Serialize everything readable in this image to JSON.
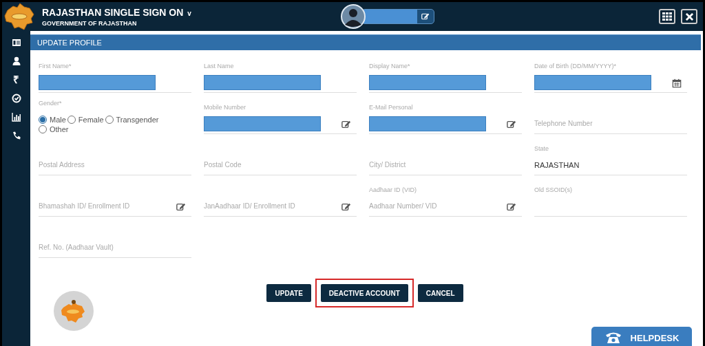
{
  "header": {
    "title": "RAJASTHAN SINGLE SIGN ON",
    "title_caret": "v",
    "subtitle": "GOVERNMENT OF RAJASTHAN",
    "user": {
      "name_redacted": true
    }
  },
  "sidebar": {
    "items": [
      {
        "kind": "id-card"
      },
      {
        "kind": "user"
      },
      {
        "kind": "glyph",
        "glyph": "₹"
      },
      {
        "kind": "check"
      },
      {
        "kind": "chart"
      },
      {
        "kind": "phone"
      }
    ]
  },
  "panel": {
    "title": "UPDATE PROFILE"
  },
  "form": {
    "rows": [
      [
        {
          "kind": "input",
          "label": "First Name*",
          "redacted": true
        },
        {
          "kind": "input",
          "label": "Last Name",
          "redacted": true
        },
        {
          "kind": "input",
          "label": "Display Name*",
          "redacted": true
        },
        {
          "kind": "date",
          "label": "Date of Birth (DD/MM/YYYY)*",
          "redacted": true
        }
      ],
      [
        {
          "kind": "radio",
          "label": "Gender*",
          "options": [
            {
              "label": "Male",
              "selected": true
            },
            {
              "label": "Female",
              "selected": false
            },
            {
              "label": "Transgender",
              "selected": false
            },
            {
              "label": "Other",
              "selected": false
            }
          ]
        },
        {
          "kind": "editable",
          "label": "Mobile Number",
          "redacted": true
        },
        {
          "kind": "editable",
          "label": "E-Mail Personal",
          "redacted": true
        },
        {
          "kind": "input",
          "placeholder": "Telephone Number"
        }
      ],
      [
        {
          "kind": "input",
          "placeholder": "Postal Address"
        },
        {
          "kind": "input",
          "placeholder": "Postal Code"
        },
        {
          "kind": "input",
          "placeholder": "City/ District"
        },
        {
          "kind": "input",
          "label": "State",
          "value": "RAJASTHAN"
        }
      ],
      [
        {
          "kind": "editable",
          "placeholder": "Bhamashah ID/ Enrollment ID"
        },
        {
          "kind": "editable",
          "placeholder": "JanAadhaar ID/ Enrollment ID"
        },
        {
          "kind": "editable",
          "label": "Aadhaar ID (VID)",
          "placeholder": "Aadhaar Number/ VID"
        },
        {
          "kind": "input",
          "label": "Old SSOID(s)"
        }
      ],
      [
        {
          "kind": "input",
          "placeholder": "Ref. No. (Aadhaar Vault)"
        }
      ]
    ]
  },
  "buttons": [
    {
      "label": "UPDATE",
      "highlighted": false
    },
    {
      "label": "DEACTIVE ACCOUNT",
      "highlighted": true
    },
    {
      "label": "CANCEL",
      "highlighted": false
    }
  ],
  "helpdesk": {
    "label": "HELPDESK"
  }
}
